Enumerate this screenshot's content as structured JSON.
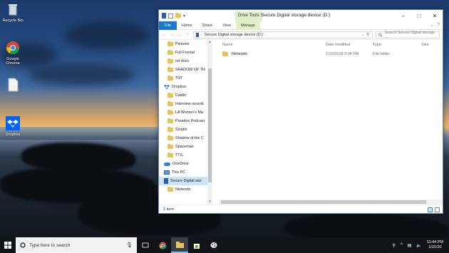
{
  "desktop": {
    "icons": [
      {
        "label": "Recycle Bin"
      },
      {
        "label": "Google Chrome"
      },
      {
        "label": ""
      },
      {
        "label": "Dropbox"
      }
    ]
  },
  "window": {
    "title": "Secure Digital storage device (D:)",
    "contextual_tab": "Drive Tools",
    "ribbon_tabs": [
      "File",
      "Home",
      "Share",
      "View",
      "Manage"
    ],
    "address": "Secure Digital storage device (D:)",
    "search_placeholder": "Search Secure Digital storage ...",
    "nav_items": [
      {
        "label": "Pictures",
        "icon": "folder-icon",
        "level": 1
      },
      {
        "label": "Full Frontal",
        "icon": "folder-icon",
        "level": 1
      },
      {
        "label": "ref docs",
        "icon": "folder-icon",
        "level": 1
      },
      {
        "label": "SHADOW OF TH",
        "icon": "folder-icon",
        "level": 1
      },
      {
        "label": "TNT",
        "icon": "folder-icon",
        "level": 1
      },
      {
        "label": "Dropbox",
        "icon": "dropbox-icon",
        "level": 0
      },
      {
        "label": "Caitlin",
        "icon": "folder-icon",
        "level": 1
      },
      {
        "label": "Interview recordi",
        "icon": "folder-icon",
        "level": 1
      },
      {
        "label": "LA Women's Ma",
        "icon": "folder-icon",
        "level": 1
      },
      {
        "label": "Paradox Podcast",
        "icon": "folder-icon",
        "level": 1
      },
      {
        "label": "Scripts",
        "icon": "folder-icon",
        "level": 1
      },
      {
        "label": "Shadow of the C",
        "icon": "folder-icon",
        "level": 1
      },
      {
        "label": "Spaceman",
        "icon": "folder-icon",
        "level": 1
      },
      {
        "label": "TTG",
        "icon": "folder-icon",
        "level": 1
      },
      {
        "label": "OneDrive",
        "icon": "onedrive-icon",
        "level": 0
      },
      {
        "label": "This PC",
        "icon": "pc-icon",
        "level": 0
      },
      {
        "label": "Secure Digital stor",
        "icon": "sd-card-icon",
        "level": 0,
        "selected": true
      },
      {
        "label": "Nintendo",
        "icon": "folder-icon",
        "level": 1
      }
    ],
    "columns": {
      "name": "Name",
      "date": "Date modified",
      "type": "Type",
      "size": "Size"
    },
    "files": [
      {
        "name": "Nintendo",
        "date": "1/10/2018 3:04 PM",
        "type": "File folder",
        "size": ""
      }
    ],
    "status": "1 item"
  },
  "taskbar": {
    "search_placeholder": "Type here to search",
    "time": "11:44 PM",
    "date": "1/31/20"
  },
  "colors": {
    "accent": "#1979ca",
    "context_tab": "#dff0c9",
    "selection": "#cce4f7",
    "taskbar": "#101317"
  }
}
